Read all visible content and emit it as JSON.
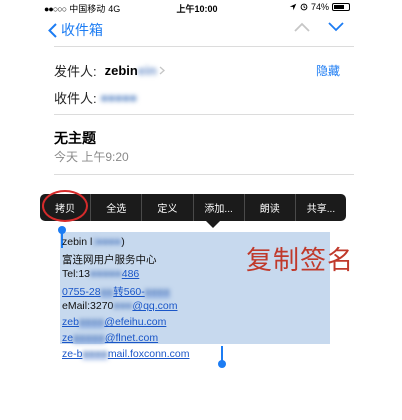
{
  "status_bar": {
    "signal_dots": "●●○○○",
    "carrier": "中国移动",
    "network": "4G",
    "time": "上午10:00",
    "battery_percent": "74%",
    "battery_level": 0.74
  },
  "nav": {
    "back_label": "收件箱"
  },
  "mail": {
    "from_label": "发件人:",
    "from_value": "zebin",
    "to_label": "收件人:",
    "to_value": "",
    "hide_label": "隐藏",
    "subject": "无主题",
    "date": "今天 上午9:20"
  },
  "context_menu": {
    "items": [
      "拷贝",
      "全选",
      "定义",
      "添加...",
      "朗读",
      "共享..."
    ]
  },
  "signature": {
    "lines": [
      "zebin l",
      "富连网用户服务中心",
      "Tel:13",
      "0755-28",
      "eMail:3270",
      "zeb",
      "ze",
      "ze-b"
    ],
    "suffixes": [
      ")",
      "",
      "486",
      "转560-",
      "@qq.com",
      "@efeihu.com",
      "@flnet.com",
      "mail.foxconn.com"
    ]
  },
  "annotation": {
    "text": "复制签名",
    "color": "#c0392b"
  },
  "colors": {
    "accent": "#1c7cf3",
    "selection": "#c7d9ee",
    "menu_bg": "#1b1b1b"
  }
}
